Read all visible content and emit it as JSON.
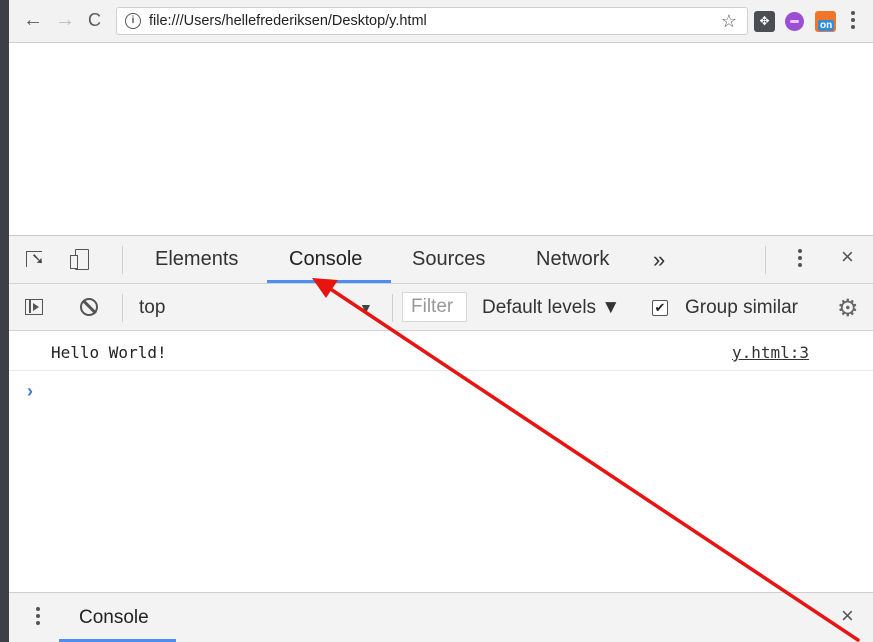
{
  "browser": {
    "url": "file:///Users/hellefrederiksen/Desktop/y.html",
    "back_glyph": "←",
    "forward_glyph": "→",
    "reload_glyph": "C",
    "star_glyph": "☆",
    "ext_badge": "on"
  },
  "devtools": {
    "tabs": [
      {
        "label": "Elements"
      },
      {
        "label": "Console",
        "active": true
      },
      {
        "label": "Sources"
      },
      {
        "label": "Network"
      }
    ],
    "more_glyph": "»",
    "close_glyph": "×"
  },
  "console_toolbar": {
    "context": "top",
    "context_arrow": "▼",
    "filter_placeholder": "Filter",
    "levels": "Default levels ▼",
    "group_similar": "Group similar",
    "group_checked": true,
    "gear_glyph": "⚙"
  },
  "console": {
    "messages": [
      {
        "text": "Hello World!",
        "source": "y.html:3"
      }
    ],
    "prompt": "›"
  },
  "drawer": {
    "tab": "Console",
    "close_glyph": "×"
  },
  "colors": {
    "accent": "#4c8ff1",
    "annotation_arrow": "#e8140f"
  }
}
